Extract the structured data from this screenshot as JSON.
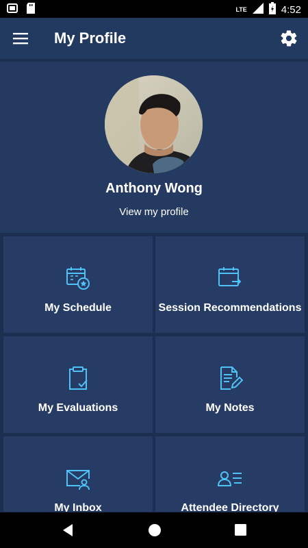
{
  "status_bar": {
    "time": "4:52",
    "network": "LTE",
    "icons": [
      "notification-icon",
      "sd-card-icon",
      "signal-icon",
      "battery-charging-icon"
    ]
  },
  "app_bar": {
    "title": "My Profile",
    "menu_icon": "hamburger-menu-icon",
    "settings_icon": "gear-icon"
  },
  "profile": {
    "name": "Anthony Wong",
    "link": "View my profile"
  },
  "tiles": [
    {
      "label": "My Schedule",
      "icon": "calendar-star-icon"
    },
    {
      "label": "Session Recommendations",
      "icon": "calendar-arrow-icon"
    },
    {
      "label": "My Evaluations",
      "icon": "clipboard-check-icon"
    },
    {
      "label": "My Notes",
      "icon": "note-pencil-icon"
    },
    {
      "label": "My Inbox",
      "icon": "envelope-user-icon"
    },
    {
      "label": "Attendee Directory",
      "icon": "person-list-icon"
    }
  ],
  "colors": {
    "accent": "#4fc3f7",
    "background": "#1d2f50",
    "tile": "#263c64"
  }
}
